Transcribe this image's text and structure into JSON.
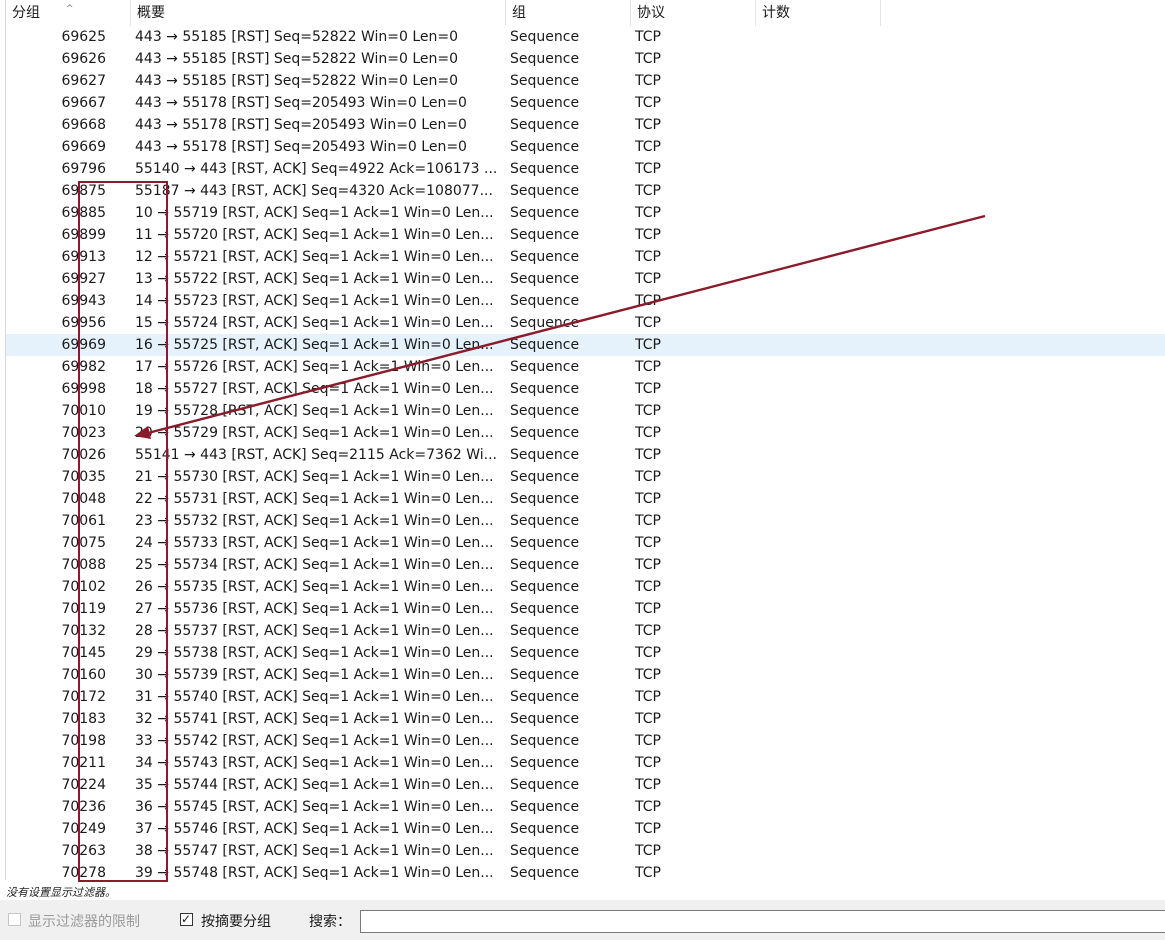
{
  "columns": {
    "no": "分组",
    "summary": "概要",
    "group": "组",
    "protocol": "协议",
    "count": "计数"
  },
  "sort_indicator": "^",
  "rows": [
    {
      "no": "69625",
      "summary": "443 → 55185 [RST] Seq=52822 Win=0 Len=0",
      "group": "Sequence",
      "protocol": "TCP"
    },
    {
      "no": "69626",
      "summary": "443 → 55185 [RST] Seq=52822 Win=0 Len=0",
      "group": "Sequence",
      "protocol": "TCP"
    },
    {
      "no": "69627",
      "summary": "443 → 55185 [RST] Seq=52822 Win=0 Len=0",
      "group": "Sequence",
      "protocol": "TCP"
    },
    {
      "no": "69667",
      "summary": "443 → 55178 [RST] Seq=205493 Win=0 Len=0",
      "group": "Sequence",
      "protocol": "TCP"
    },
    {
      "no": "69668",
      "summary": "443 → 55178 [RST] Seq=205493 Win=0 Len=0",
      "group": "Sequence",
      "protocol": "TCP"
    },
    {
      "no": "69669",
      "summary": "443 → 55178 [RST] Seq=205493 Win=0 Len=0",
      "group": "Sequence",
      "protocol": "TCP"
    },
    {
      "no": "69796",
      "summary": "55140 → 443 [RST, ACK] Seq=4922 Ack=106173 ...",
      "group": "Sequence",
      "protocol": "TCP"
    },
    {
      "no": "69875",
      "summary": "55187 → 443 [RST, ACK] Seq=4320 Ack=108077...",
      "group": "Sequence",
      "protocol": "TCP"
    },
    {
      "no": "69885",
      "summary": "10 → 55719 [RST, ACK] Seq=1 Ack=1 Win=0 Len...",
      "group": "Sequence",
      "protocol": "TCP"
    },
    {
      "no": "69899",
      "summary": "11 → 55720 [RST, ACK] Seq=1 Ack=1 Win=0 Len...",
      "group": "Sequence",
      "protocol": "TCP"
    },
    {
      "no": "69913",
      "summary": "12 → 55721 [RST, ACK] Seq=1 Ack=1 Win=0 Len...",
      "group": "Sequence",
      "protocol": "TCP"
    },
    {
      "no": "69927",
      "summary": "13 → 55722 [RST, ACK] Seq=1 Ack=1 Win=0 Len...",
      "group": "Sequence",
      "protocol": "TCP"
    },
    {
      "no": "69943",
      "summary": "14 → 55723 [RST, ACK] Seq=1 Ack=1 Win=0 Len...",
      "group": "Sequence",
      "protocol": "TCP"
    },
    {
      "no": "69956",
      "summary": "15 → 55724 [RST, ACK] Seq=1 Ack=1 Win=0 Len...",
      "group": "Sequence",
      "protocol": "TCP"
    },
    {
      "no": "69969",
      "summary": "16 → 55725 [RST, ACK] Seq=1 Ack=1 Win=0 Len...",
      "group": "Sequence",
      "protocol": "TCP",
      "selected": true
    },
    {
      "no": "69982",
      "summary": "17 → 55726 [RST, ACK] Seq=1 Ack=1 Win=0 Len...",
      "group": "Sequence",
      "protocol": "TCP"
    },
    {
      "no": "69998",
      "summary": "18 → 55727 [RST, ACK] Seq=1 Ack=1 Win=0 Len...",
      "group": "Sequence",
      "protocol": "TCP"
    },
    {
      "no": "70010",
      "summary": "19 → 55728 [RST, ACK] Seq=1 Ack=1 Win=0 Len...",
      "group": "Sequence",
      "protocol": "TCP"
    },
    {
      "no": "70023",
      "summary": "20 → 55729 [RST, ACK] Seq=1 Ack=1 Win=0 Len...",
      "group": "Sequence",
      "protocol": "TCP"
    },
    {
      "no": "70026",
      "summary": "55141 → 443 [RST, ACK] Seq=2115 Ack=7362 Wi...",
      "group": "Sequence",
      "protocol": "TCP"
    },
    {
      "no": "70035",
      "summary": "21 → 55730 [RST, ACK] Seq=1 Ack=1 Win=0 Len...",
      "group": "Sequence",
      "protocol": "TCP"
    },
    {
      "no": "70048",
      "summary": "22 → 55731 [RST, ACK] Seq=1 Ack=1 Win=0 Len...",
      "group": "Sequence",
      "protocol": "TCP"
    },
    {
      "no": "70061",
      "summary": "23 → 55732 [RST, ACK] Seq=1 Ack=1 Win=0 Len...",
      "group": "Sequence",
      "protocol": "TCP"
    },
    {
      "no": "70075",
      "summary": "24 → 55733 [RST, ACK] Seq=1 Ack=1 Win=0 Len...",
      "group": "Sequence",
      "protocol": "TCP"
    },
    {
      "no": "70088",
      "summary": "25 → 55734 [RST, ACK] Seq=1 Ack=1 Win=0 Len...",
      "group": "Sequence",
      "protocol": "TCP"
    },
    {
      "no": "70102",
      "summary": "26 → 55735 [RST, ACK] Seq=1 Ack=1 Win=0 Len...",
      "group": "Sequence",
      "protocol": "TCP"
    },
    {
      "no": "70119",
      "summary": "27 → 55736 [RST, ACK] Seq=1 Ack=1 Win=0 Len...",
      "group": "Sequence",
      "protocol": "TCP"
    },
    {
      "no": "70132",
      "summary": "28 → 55737 [RST, ACK] Seq=1 Ack=1 Win=0 Len...",
      "group": "Sequence",
      "protocol": "TCP"
    },
    {
      "no": "70145",
      "summary": "29 → 55738 [RST, ACK] Seq=1 Ack=1 Win=0 Len...",
      "group": "Sequence",
      "protocol": "TCP"
    },
    {
      "no": "70160",
      "summary": "30 → 55739 [RST, ACK] Seq=1 Ack=1 Win=0 Len...",
      "group": "Sequence",
      "protocol": "TCP"
    },
    {
      "no": "70172",
      "summary": "31 → 55740 [RST, ACK] Seq=1 Ack=1 Win=0 Len...",
      "group": "Sequence",
      "protocol": "TCP"
    },
    {
      "no": "70183",
      "summary": "32 → 55741 [RST, ACK] Seq=1 Ack=1 Win=0 Len...",
      "group": "Sequence",
      "protocol": "TCP"
    },
    {
      "no": "70198",
      "summary": "33 → 55742 [RST, ACK] Seq=1 Ack=1 Win=0 Len...",
      "group": "Sequence",
      "protocol": "TCP"
    },
    {
      "no": "70211",
      "summary": "34 → 55743 [RST, ACK] Seq=1 Ack=1 Win=0 Len...",
      "group": "Sequence",
      "protocol": "TCP"
    },
    {
      "no": "70224",
      "summary": "35 → 55744 [RST, ACK] Seq=1 Ack=1 Win=0 Len...",
      "group": "Sequence",
      "protocol": "TCP"
    },
    {
      "no": "70236",
      "summary": "36 → 55745 [RST, ACK] Seq=1 Ack=1 Win=0 Len...",
      "group": "Sequence",
      "protocol": "TCP"
    },
    {
      "no": "70249",
      "summary": "37 → 55746 [RST, ACK] Seq=1 Ack=1 Win=0 Len...",
      "group": "Sequence",
      "protocol": "TCP"
    },
    {
      "no": "70263",
      "summary": "38 → 55747 [RST, ACK] Seq=1 Ack=1 Win=0 Len...",
      "group": "Sequence",
      "protocol": "TCP"
    },
    {
      "no": "70278",
      "summary": "39 → 55748 [RST, ACK] Seq=1 Ack=1 Win=0 Len...",
      "group": "Sequence",
      "protocol": "TCP"
    }
  ],
  "status_text": "没有设置显示过滤器。",
  "bottom": {
    "filter_limit_label": "显示过滤器的限制",
    "filter_limit_checked": false,
    "filter_limit_enabled": false,
    "group_by_summary_label": "按摘要分组",
    "group_by_summary_checked": true,
    "search_label": "搜索：",
    "search_value": ""
  },
  "colors": {
    "selected_row": "#e5f1fb",
    "annotation": "#8b1a2b"
  },
  "icons": {
    "checkbox_checked": "✓"
  }
}
